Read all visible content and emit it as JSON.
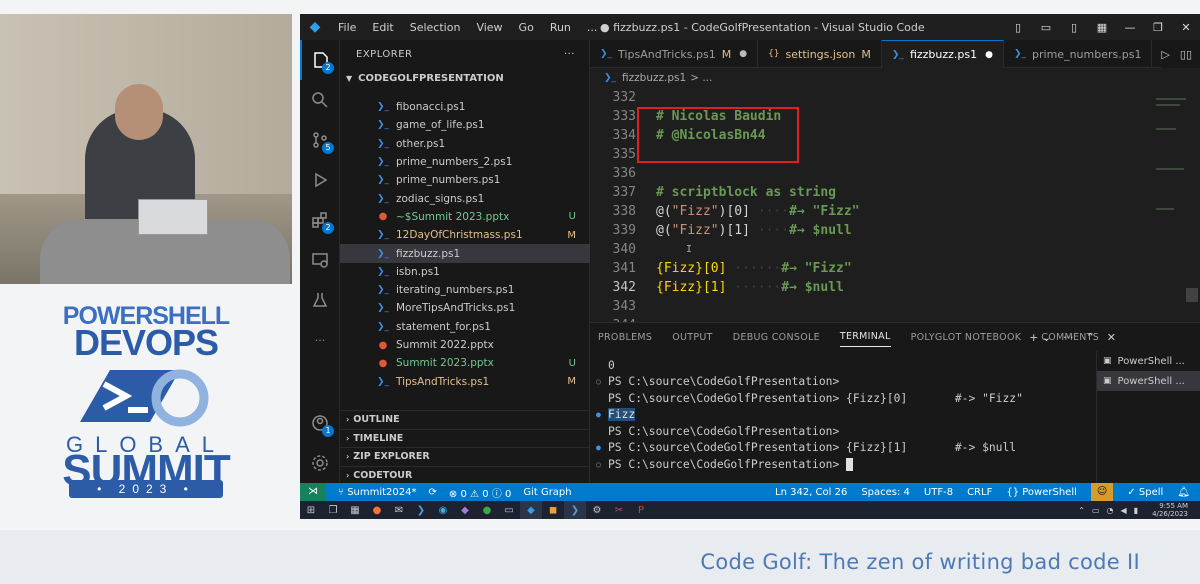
{
  "window": {
    "title": "● fizzbuzz.ps1 - CodeGolfPresentation - Visual Studio Code",
    "menu": [
      "File",
      "Edit",
      "Selection",
      "View",
      "Go",
      "Run",
      "..."
    ]
  },
  "activity_bar": {
    "explorer_badge": "2",
    "scm_badge": "5",
    "extensions_badge": "2",
    "accounts_badge": "1"
  },
  "sidebar": {
    "title": "EXPLORER",
    "more": "···",
    "project": "CODEGOLFPRESENTATION",
    "files": [
      {
        "name": "fibonacci.ps1",
        "type": "ps1",
        "status": ""
      },
      {
        "name": "game_of_life.ps1",
        "type": "ps1",
        "status": ""
      },
      {
        "name": "other.ps1",
        "type": "ps1",
        "status": ""
      },
      {
        "name": "prime_numbers_2.ps1",
        "type": "ps1",
        "status": ""
      },
      {
        "name": "prime_numbers.ps1",
        "type": "ps1",
        "status": ""
      },
      {
        "name": "zodiac_signs.ps1",
        "type": "ps1",
        "status": ""
      },
      {
        "name": "~$Summit 2023.pptx",
        "type": "pptx",
        "status": "U"
      },
      {
        "name": "12DayOfChristmass.ps1",
        "type": "ps1",
        "status": "M"
      },
      {
        "name": "fizzbuzz.ps1",
        "type": "ps1",
        "status": ""
      },
      {
        "name": "isbn.ps1",
        "type": "ps1",
        "status": ""
      },
      {
        "name": "iterating_numbers.ps1",
        "type": "ps1",
        "status": ""
      },
      {
        "name": "MoreTipsAndTricks.ps1",
        "type": "ps1",
        "status": ""
      },
      {
        "name": "statement_for.ps1",
        "type": "ps1",
        "status": ""
      },
      {
        "name": "Summit 2022.pptx",
        "type": "pptx",
        "status": ""
      },
      {
        "name": "Summit 2023.pptx",
        "type": "pptx",
        "status": "U"
      },
      {
        "name": "TipsAndTricks.ps1",
        "type": "ps1",
        "status": "M"
      }
    ],
    "sections": [
      "OUTLINE",
      "TIMELINE",
      "ZIP EXPLORER",
      "CODETOUR"
    ]
  },
  "tabs": [
    {
      "label": "TipsAndTricks.ps1",
      "suffix": "M",
      "marker": "●"
    },
    {
      "label": "settings.json",
      "suffix": "M",
      "marker": ""
    },
    {
      "label": "fizzbuzz.ps1",
      "suffix": "",
      "marker": "●"
    },
    {
      "label": "prime_numbers.ps1",
      "suffix": "",
      "marker": ""
    }
  ],
  "breadcrumb": {
    "file": "fizzbuzz.ps1",
    "rest": "> ..."
  },
  "code": {
    "line_numbers": [
      "332",
      "333",
      "334",
      "335",
      "336",
      "337",
      "338",
      "339",
      "340",
      "341",
      "342",
      "343",
      "344"
    ],
    "l333": "# Nicolas Baudin",
    "l334": "# @NicolasBn44",
    "l337": "# scriptblock as string",
    "l338_a": "@(",
    "l338_b": "\"Fizz\"",
    "l338_c": ")[0]",
    "l338_ws": " ····",
    "l338_d": "#→ \"Fizz\"",
    "l339_a": "@(",
    "l339_b": "\"Fizz\"",
    "l339_c": ")[1]",
    "l339_ws": " ····",
    "l339_d": "#→ $null",
    "l340": "I",
    "l341_a": "{Fizz}[0]",
    "l341_ws": " ······",
    "l341_d": "#→ \"Fizz\"",
    "l342_a": "{Fizz}[1]",
    "l342_ws": " ······",
    "l342_d": "#→ $null"
  },
  "panel": {
    "tabs": [
      "PROBLEMS",
      "OUTPUT",
      "DEBUG CONSOLE",
      "TERMINAL",
      "POLYGLOT NOTEBOOK",
      "COMMENTS"
    ],
    "active_tab": "TERMINAL",
    "terminal_lines": [
      {
        "marker": "",
        "text": "0"
      },
      {
        "marker": "○",
        "text": "PS C:\\source\\CodeGolfPresentation>"
      },
      {
        "marker": "",
        "text": "PS C:\\source\\CodeGolfPresentation> {Fizz}[0]       #-> \"Fizz\""
      },
      {
        "marker": "●",
        "text": "Fizz"
      },
      {
        "marker": "",
        "text": "PS C:\\source\\CodeGolfPresentation>"
      },
      {
        "marker": "●",
        "text": "PS C:\\source\\CodeGolfPresentation> {Fizz}[1]       #-> $null"
      },
      {
        "marker": "○",
        "text": "PS C:\\source\\CodeGolfPresentation> "
      }
    ],
    "terminals": [
      "PowerShell ...",
      "PowerShell ..."
    ]
  },
  "status": {
    "branch": "Summit2024*",
    "errors": "0",
    "warnings": "0",
    "info": "0",
    "git_graph": "Git Graph",
    "position": "Ln 342, Col 26",
    "spaces": "Spaces: 4",
    "encoding": "UTF-8",
    "eol": "CRLF",
    "language": "PowerShell",
    "spell": "Spell"
  },
  "taskbar": {
    "time": "9:55 AM",
    "date": "4/26/2023"
  },
  "conference": {
    "line1": "POWERSHELL",
    "line2": "DEVOPS",
    "line3": "GLOBAL",
    "line4": "SUMMIT",
    "year": "• 2023 •"
  },
  "caption": "Code Golf: The zen of writing bad code II",
  "colors": {
    "accent": "#007acc",
    "comment": "#6a9955",
    "string": "#ce9178",
    "bracket": "#ffd700",
    "modified": "#e2c08d",
    "untracked": "#73c991",
    "highlight_box": "#e02020",
    "caption": "#4a7bb6"
  }
}
